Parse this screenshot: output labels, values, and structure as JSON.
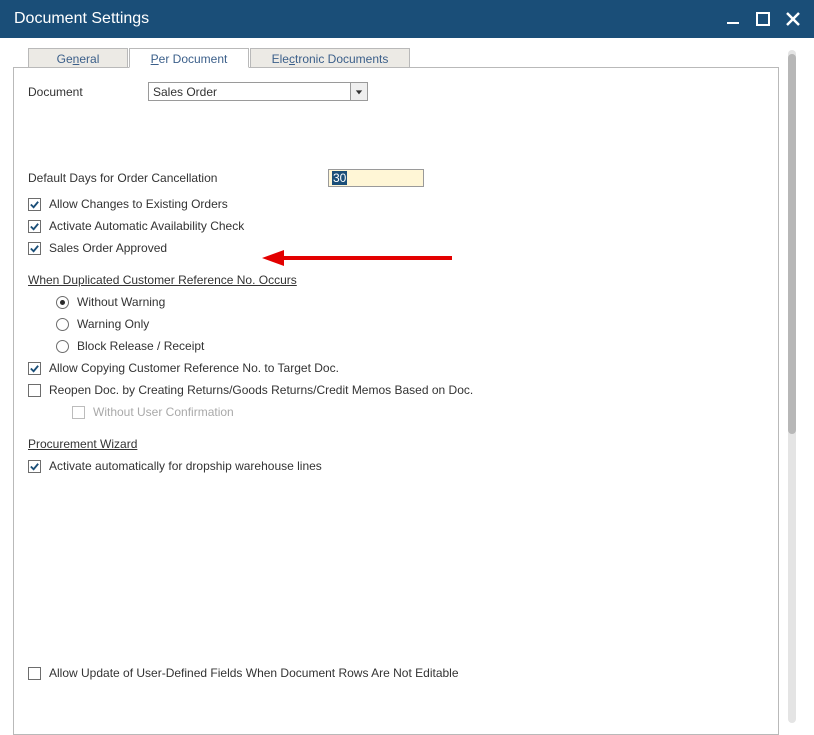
{
  "titlebar": {
    "title": "Document Settings"
  },
  "tabs": {
    "general_pre": "Ge",
    "general_accel": "n",
    "general_post": "eral",
    "per_doc_accel": "P",
    "per_doc_post": "er Document",
    "elec_pre": "Ele",
    "elec_accel": "c",
    "elec_post": "tronic Documents"
  },
  "document": {
    "label": "Document",
    "selected": "Sales Order"
  },
  "fields": {
    "default_days_label": "Default Days for Order Cancellation",
    "default_days_value": "30"
  },
  "checks": {
    "allow_changes": "Allow Changes to Existing Orders",
    "activate_auto": "Activate Automatic Availability Check",
    "sales_approved": "Sales Order Approved",
    "allow_copy_ref": "Allow Copying Customer Reference No. to Target Doc.",
    "reopen_doc": "Reopen Doc. by Creating Returns/Goods Returns/Credit Memos Based on Doc.",
    "without_confirm": "Without User Confirmation",
    "activate_dropship": "Activate automatically for dropship warehouse lines",
    "allow_udf": "Allow Update of User-Defined Fields When Document Rows Are Not Editable"
  },
  "dup_ref": {
    "heading": "When Duplicated Customer Reference No. Occurs",
    "opt1": "Without Warning",
    "opt2": "Warning Only",
    "opt3": "Block Release / Receipt"
  },
  "proc_wizard": {
    "heading": "Procurement Wizard"
  }
}
